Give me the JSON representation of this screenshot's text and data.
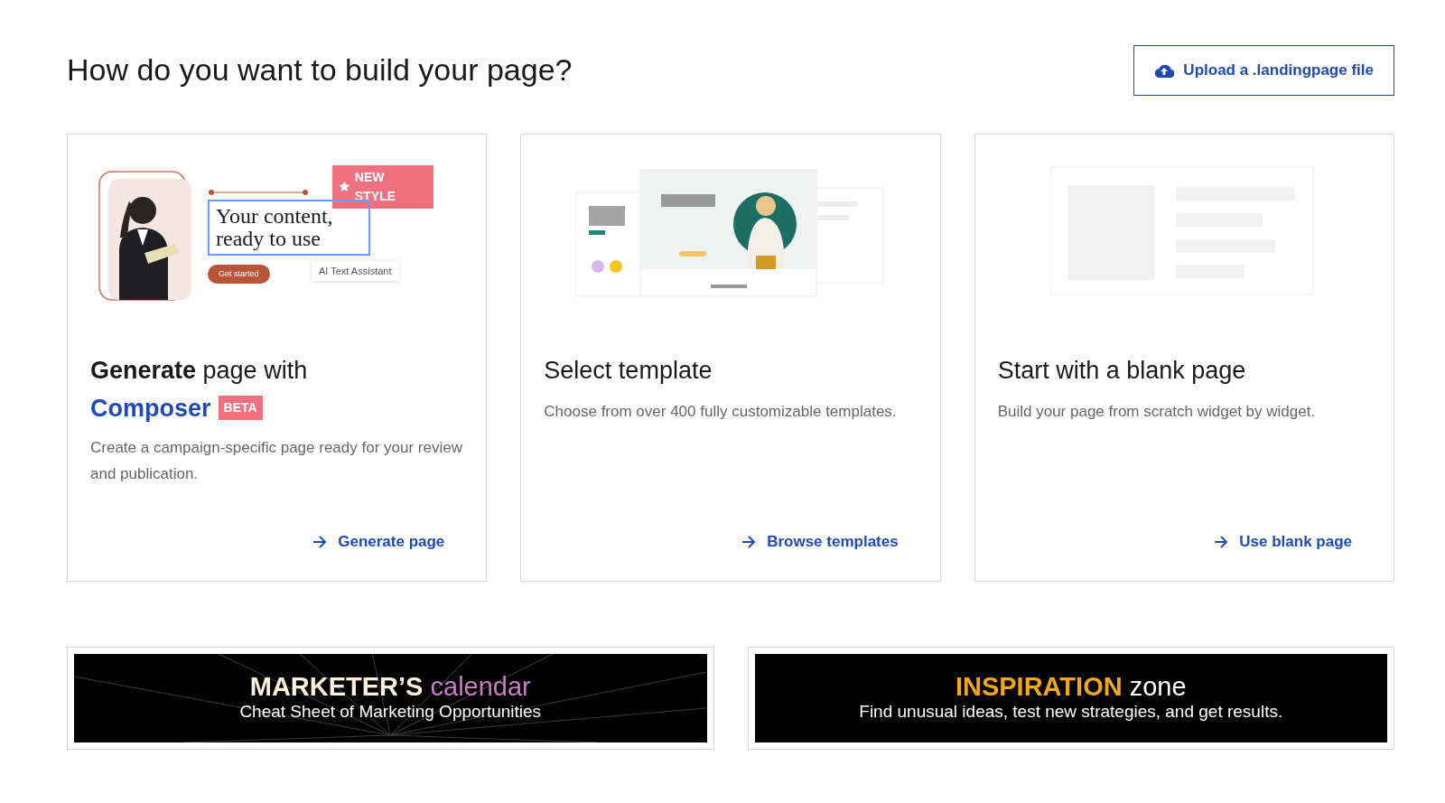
{
  "header": {
    "title": "How do you want to build your page?",
    "upload_button": "Upload a .landingpage file"
  },
  "cards": [
    {
      "kind": "generate",
      "illustration": {
        "badge": "NEW STYLE",
        "headline": "Your content, ready to use",
        "button": "Get started",
        "assistant": "AI Text Assistant"
      },
      "title": "**Generate** page with",
      "product": "Composer",
      "tag": "BETA",
      "description": "Create a campaign-specific page ready for your review and publication.",
      "link": "Generate page"
    },
    {
      "kind": "template",
      "title": "Select template",
      "description": "Choose from over 400 fully customizable templates.",
      "link": "Browse templates"
    },
    {
      "kind": "blank",
      "title": "Start with a blank page",
      "description": "Build your page from scratch widget by widget.",
      "link": "Use blank page"
    }
  ],
  "banners": [
    {
      "kind": "calendar",
      "title": "MARKETER’S",
      "title_accent": "calendar",
      "subtitle": "Cheat Sheet of Marketing Opportunities"
    },
    {
      "kind": "inspiration",
      "title": "INSPIRATION",
      "title_accent": "zone",
      "subtitle": "Find unusual ideas, test new strategies, and get results."
    }
  ]
}
